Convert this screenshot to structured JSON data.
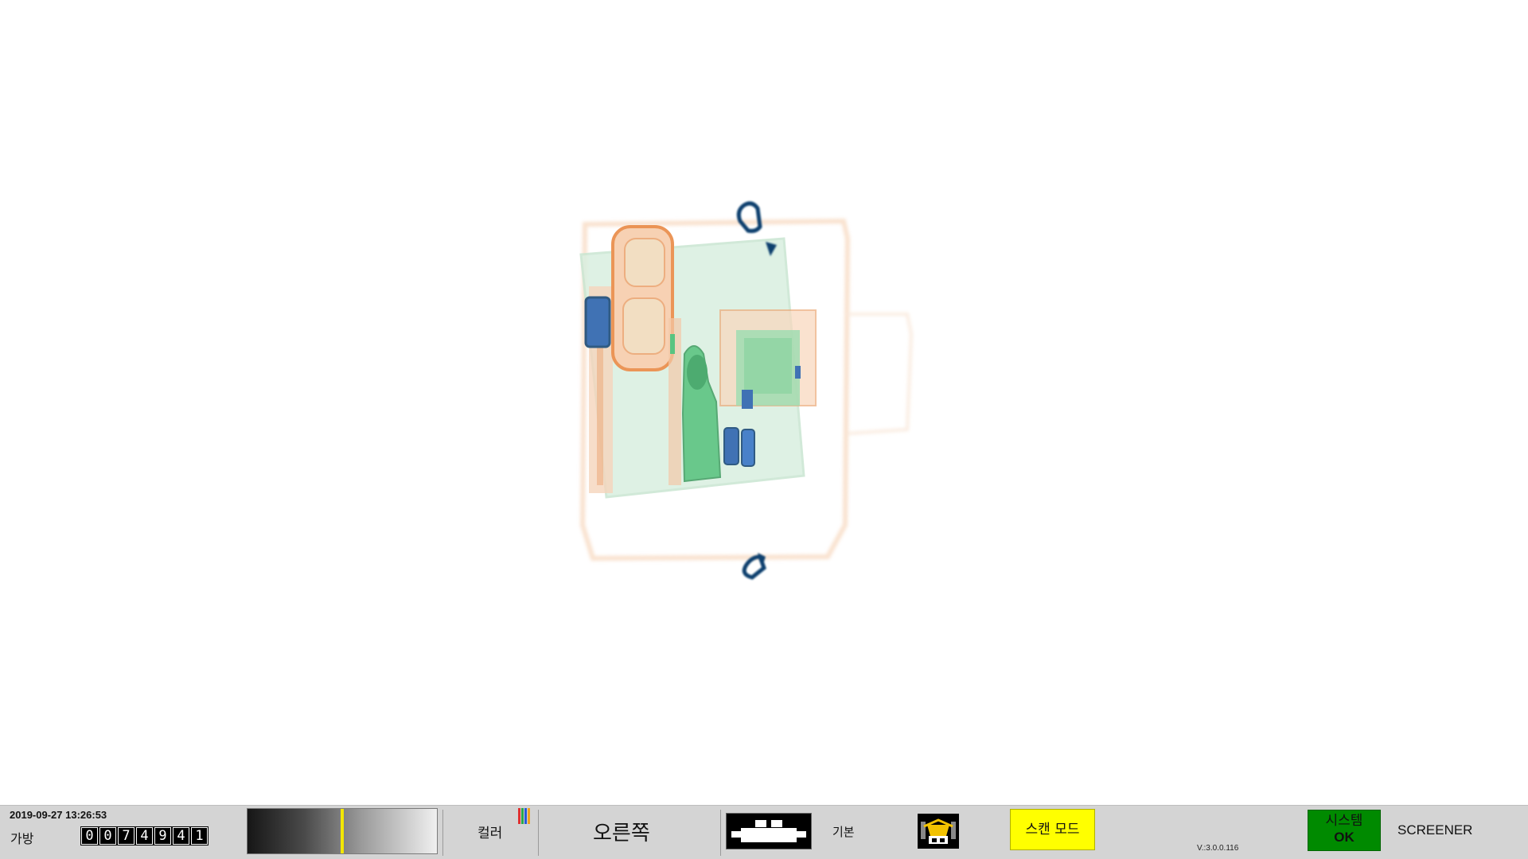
{
  "scan_image": {
    "colors": {
      "organic_orange": "#e8833a",
      "inorganic_green": "#3cba6c",
      "metal_blue": "#1f5aa8",
      "metal_dark": "#0d3f6e"
    }
  },
  "status_bar": {
    "datetime": "2019-09-27 13:26:53",
    "bag_label": "가방",
    "bag_count_digits": [
      "0",
      "0",
      "7",
      "4",
      "9",
      "4",
      "1"
    ],
    "color_label": "컬러",
    "color_icon_colors": [
      "#e03030",
      "#2aa84a",
      "#2a5ad8",
      "#f0a020"
    ],
    "direction": "오른쪽",
    "mode_label": "기본",
    "scan_mode_label": "스캔 모드",
    "version": "V.:3.0.0.116",
    "system_status_title": "시스템",
    "system_status_value": "OK",
    "system_status_color": "#008a00",
    "scan_mode_color": "#ffff00",
    "role": "SCREENER"
  },
  "icons": {
    "conveyor": "conveyor-icon",
    "alarm": "bag-alarm-icon",
    "color_palette": "color-palette-icon"
  }
}
